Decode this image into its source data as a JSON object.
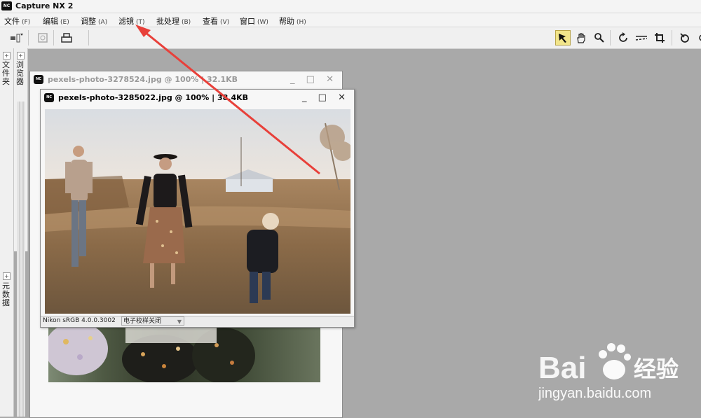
{
  "app": {
    "logo_text": "NC",
    "title": "Capture NX 2"
  },
  "menu": [
    {
      "label": "文件",
      "accel": "(F)"
    },
    {
      "label": "编辑",
      "accel": "(E)"
    },
    {
      "label": "调整",
      "accel": "(A)"
    },
    {
      "label": "滤镜",
      "accel": "(T)"
    },
    {
      "label": "批处理",
      "accel": "(B)"
    },
    {
      "label": "查看",
      "accel": "(V)"
    },
    {
      "label": "窗口",
      "accel": "(W)"
    },
    {
      "label": "帮助",
      "accel": "(H)"
    }
  ],
  "sidebar": {
    "tab1": "文件夹",
    "tab2": "浏览器",
    "tab3": "元数据"
  },
  "windows": {
    "back": {
      "title": "pexels-photo-3278524.jpg @ 100% | 32.1KB"
    },
    "front": {
      "title": "pexels-photo-3285022.jpg @ 100% | 38.4KB",
      "profile": "Nikon sRGB 4.0.0.3002",
      "proof": "电子校样关闭"
    }
  },
  "watermark": {
    "brand_latin": "Bai",
    "brand_cn": "经验",
    "url": "jingyan.baidu.com"
  },
  "colors": {
    "arrow": "#e8403a",
    "active_tool": "#f2e58a"
  }
}
